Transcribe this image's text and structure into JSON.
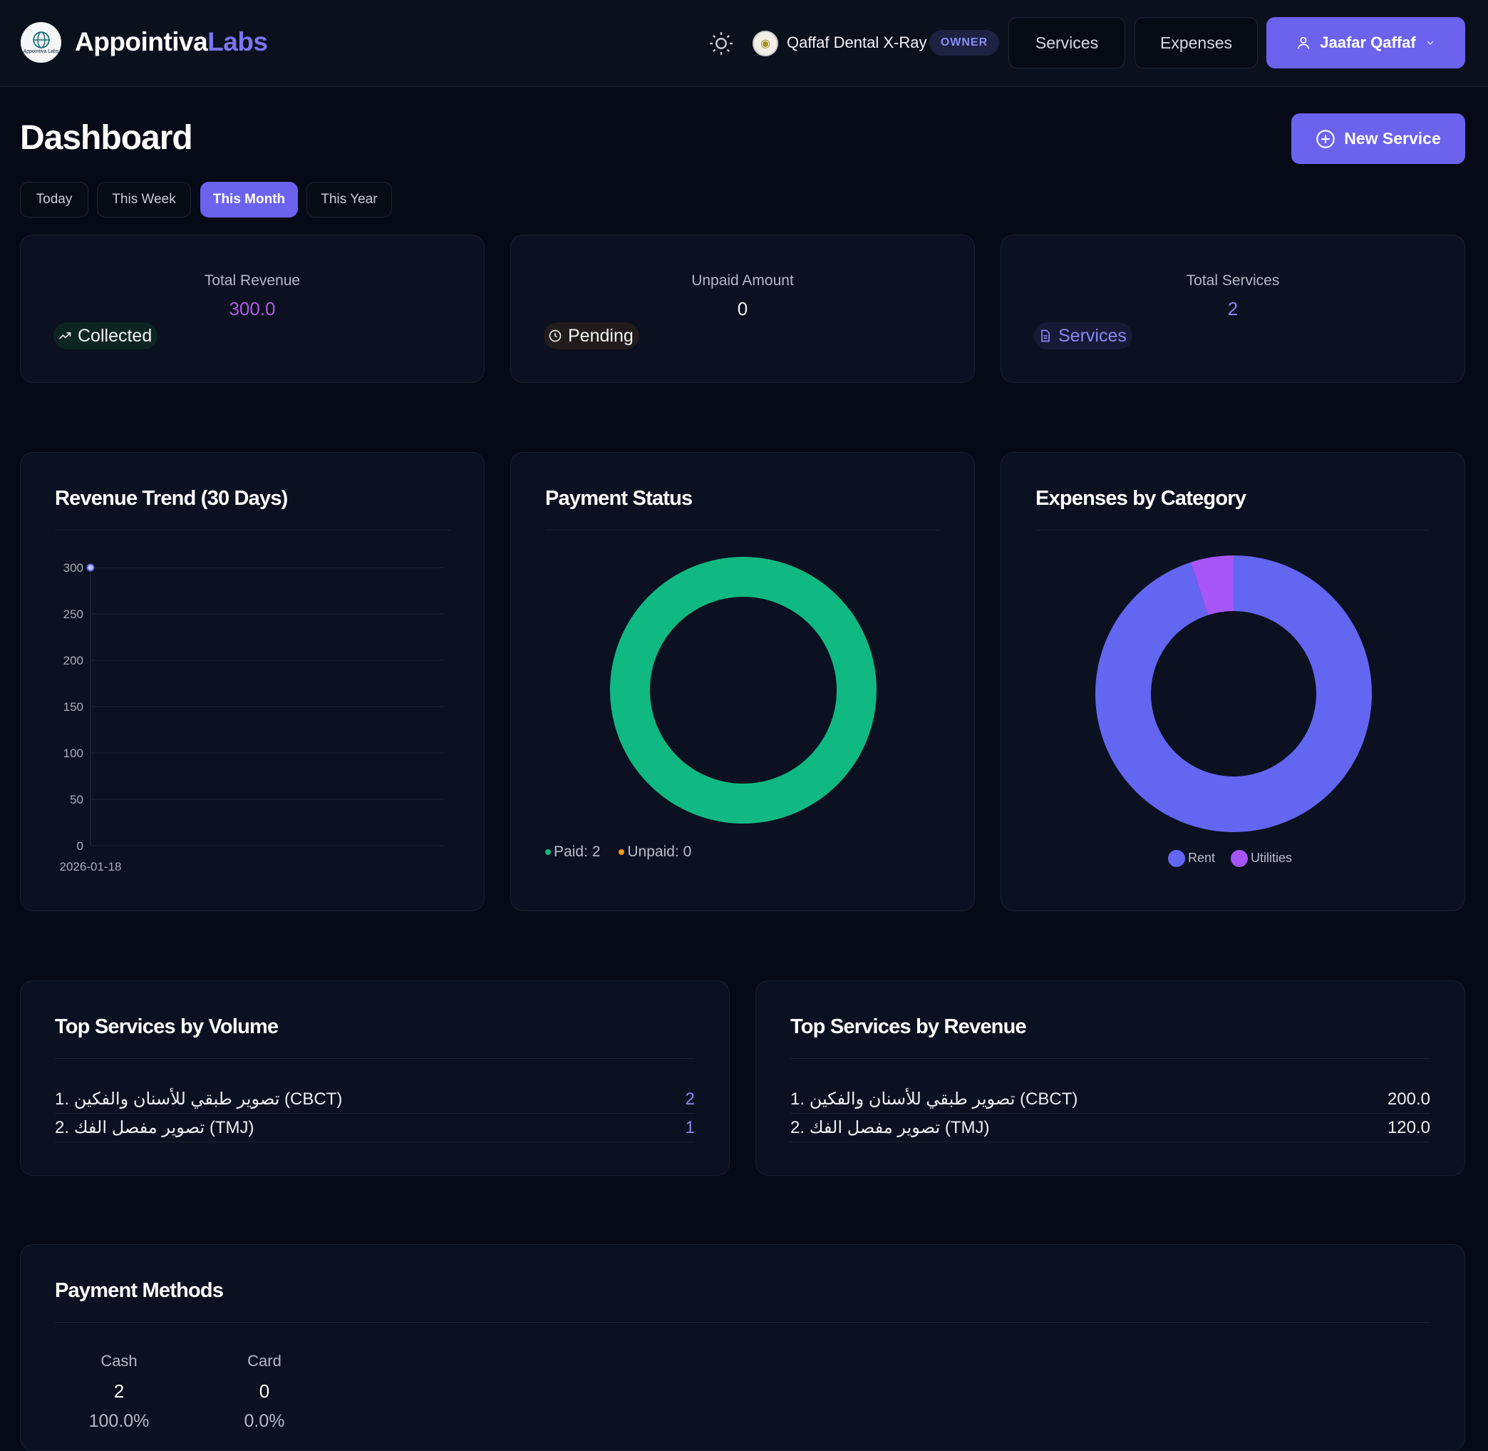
{
  "brand": {
    "part1": "Appointiva",
    "part2": "Labs",
    "logo_text": "Appointiva Labs"
  },
  "header": {
    "clinic_name": "Qaffaf Dental X-Ray",
    "role_badge": "OWNER",
    "nav": {
      "services": "Services",
      "expenses": "Expenses"
    },
    "user_name": "Jaafar Qaffaf"
  },
  "page": {
    "title": "Dashboard",
    "new_service_label": "New Service"
  },
  "filters": [
    {
      "label": "Today",
      "active": false
    },
    {
      "label": "This Week",
      "active": false
    },
    {
      "label": "This Month",
      "active": true
    },
    {
      "label": "This Year",
      "active": false
    }
  ],
  "stats": [
    {
      "label": "Total Revenue",
      "value": "300.0",
      "pill": "Collected",
      "value_color": "#b159e2",
      "pill_color": "#f2f4f7",
      "pill_bg": "#0d2522"
    },
    {
      "label": "Unpaid Amount",
      "value": "0",
      "pill": "Pending",
      "value_color": "#f2f4f7",
      "pill_color": "#f2f4f7",
      "pill_bg": "#221d1c"
    },
    {
      "label": "Total Services",
      "value": "2",
      "pill": "Services",
      "value_color": "#8b87f2",
      "pill_color": "#8b87f2",
      "pill_bg": "#161a37"
    }
  ],
  "charts_titles": {
    "revenue_trend": "Revenue Trend (30 Days)",
    "payment_status": "Payment Status",
    "expenses_by_category": "Expenses by Category"
  },
  "chart_data": [
    {
      "type": "line",
      "title": "Revenue Trend (30 Days)",
      "x": [
        "2026-01-18"
      ],
      "series": [
        {
          "values": [
            300
          ]
        }
      ],
      "yticks": [
        0,
        50,
        100,
        150,
        200,
        250,
        300
      ],
      "ylim": [
        0,
        300
      ],
      "grid": true
    },
    {
      "type": "pie",
      "title": "Payment Status",
      "categories": [
        "Paid",
        "Unpaid"
      ],
      "values": [
        2,
        0
      ],
      "legend_labels": [
        "Paid: 2",
        "Unpaid: 0"
      ],
      "colors": [
        "#10b981",
        "#f59e0b"
      ],
      "donut": true
    },
    {
      "type": "pie",
      "title": "Expenses by Category",
      "categories": [
        "Rent",
        "Utilities"
      ],
      "values": [
        95,
        5
      ],
      "colors": [
        "#6366f1",
        "#a855f7"
      ],
      "donut": true,
      "legend_position": "bottom"
    }
  ],
  "top_volume": {
    "title": "Top Services by Volume",
    "rows": [
      {
        "name": "1. تصوير طبقي للأسنان والفكين (CBCT)",
        "value": "2"
      },
      {
        "name": "2. تصوير مفصل الفك (TMJ)",
        "value": "1"
      }
    ]
  },
  "top_revenue": {
    "title": "Top Services by Revenue",
    "rows": [
      {
        "name": "1. تصوير طبقي للأسنان والفكين (CBCT)",
        "value": "200.0"
      },
      {
        "name": "2. تصوير مفصل الفك (TMJ)",
        "value": "120.0"
      }
    ]
  },
  "payment_methods": {
    "title": "Payment Methods",
    "items": [
      {
        "label": "Cash",
        "count": "2",
        "percent": "100.0%"
      },
      {
        "label": "Card",
        "count": "0",
        "percent": "0.0%"
      }
    ]
  },
  "colors": {
    "accent": "#6b63ee",
    "paid": "#10b981",
    "unpaid": "#f59e0b"
  }
}
